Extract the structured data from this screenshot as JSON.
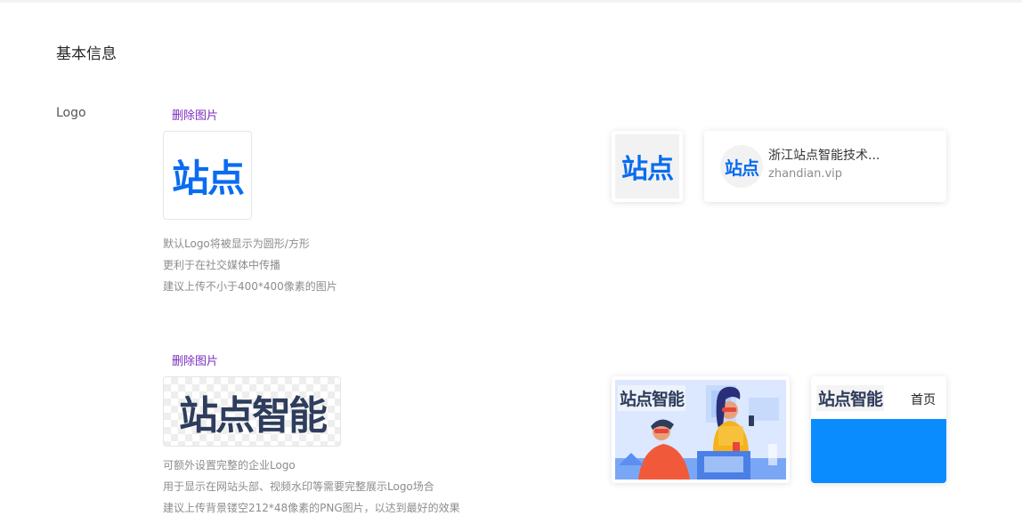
{
  "section": {
    "title": "基本信息"
  },
  "logo_field": {
    "label": "Logo",
    "delete_label": "删除图片",
    "logo_text": "站点",
    "hints": [
      "默认Logo将被显示为圆形/方形",
      "更利于在社交媒体中传播",
      "建议上传不小于400*400像素的图片"
    ]
  },
  "wide_logo_field": {
    "delete_label": "删除图片",
    "logo_text": "站点智能",
    "hints": [
      "可额外设置完整的企业Logo",
      "用于显示在网站头部、视频水印等需要完整展示Logo场合",
      "建议上传背景镂空212*48像素的PNG图片，以达到最好的效果"
    ]
  },
  "previews": {
    "square_logo_text": "站点",
    "share_card": {
      "avatar_text": "站点",
      "name": "浙江站点智能技术...",
      "url": "zhandian.vip"
    },
    "banner_logo_text": "站点智能",
    "header_logo_text": "站点智能",
    "header_nav_label": "首页"
  },
  "colors": {
    "brand_blue": "#0a6cf0",
    "brand_dark": "#2e3d5c",
    "delete_link": "#7b2fbf",
    "header_blue": "#0a8cff"
  }
}
